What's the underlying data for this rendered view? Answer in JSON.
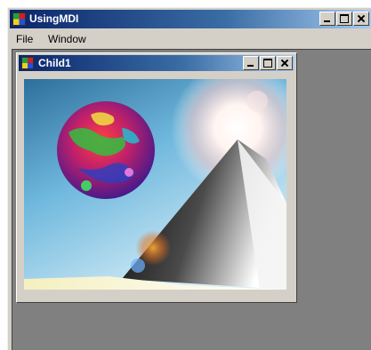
{
  "main_window": {
    "title": "UsingMDI",
    "menu": [
      {
        "label": "File"
      },
      {
        "label": "Window"
      }
    ]
  },
  "child_window": {
    "title": "Child1",
    "picture": "image"
  }
}
